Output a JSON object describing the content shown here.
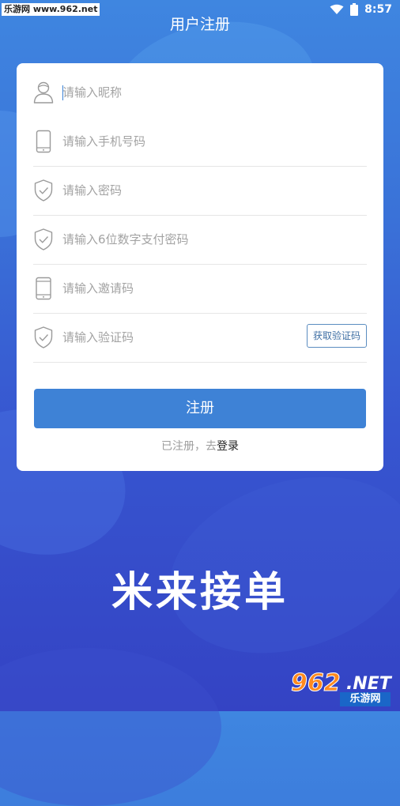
{
  "status_bar": {
    "watermark": "乐游网 www.962.net",
    "time": "8:57",
    "icons": [
      "wifi-icon",
      "battery-icon"
    ]
  },
  "header": {
    "title": "用户注册"
  },
  "form": {
    "nickname": {
      "placeholder": "请输入昵称",
      "value": "",
      "icon": "user-icon"
    },
    "phone": {
      "placeholder": "请输入手机号码",
      "value": "",
      "icon": "phone-icon"
    },
    "password": {
      "placeholder": "请输入密码",
      "value": "",
      "icon": "shield-check-icon"
    },
    "pay_password": {
      "placeholder": "请输入6位数字支付密码",
      "value": "",
      "icon": "shield-check-icon"
    },
    "invite_code": {
      "placeholder": "请输入邀请码",
      "value": "",
      "icon": "phone-icon"
    },
    "verify_code": {
      "placeholder": "请输入验证码",
      "value": "",
      "icon": "shield-check-icon"
    },
    "get_code_label": "获取验证码",
    "submit_label": "注册",
    "login_prefix": "已注册，去",
    "login_link": "登录"
  },
  "slogan": "米来接单",
  "watermark": {
    "number": "962",
    "net": ".NET",
    "cn": "乐游网"
  },
  "colors": {
    "primary": "#3e82d6",
    "background_top": "#3f86e0",
    "background_bottom": "#3443c4",
    "placeholder": "#a3a3a3",
    "card": "#ffffff"
  }
}
